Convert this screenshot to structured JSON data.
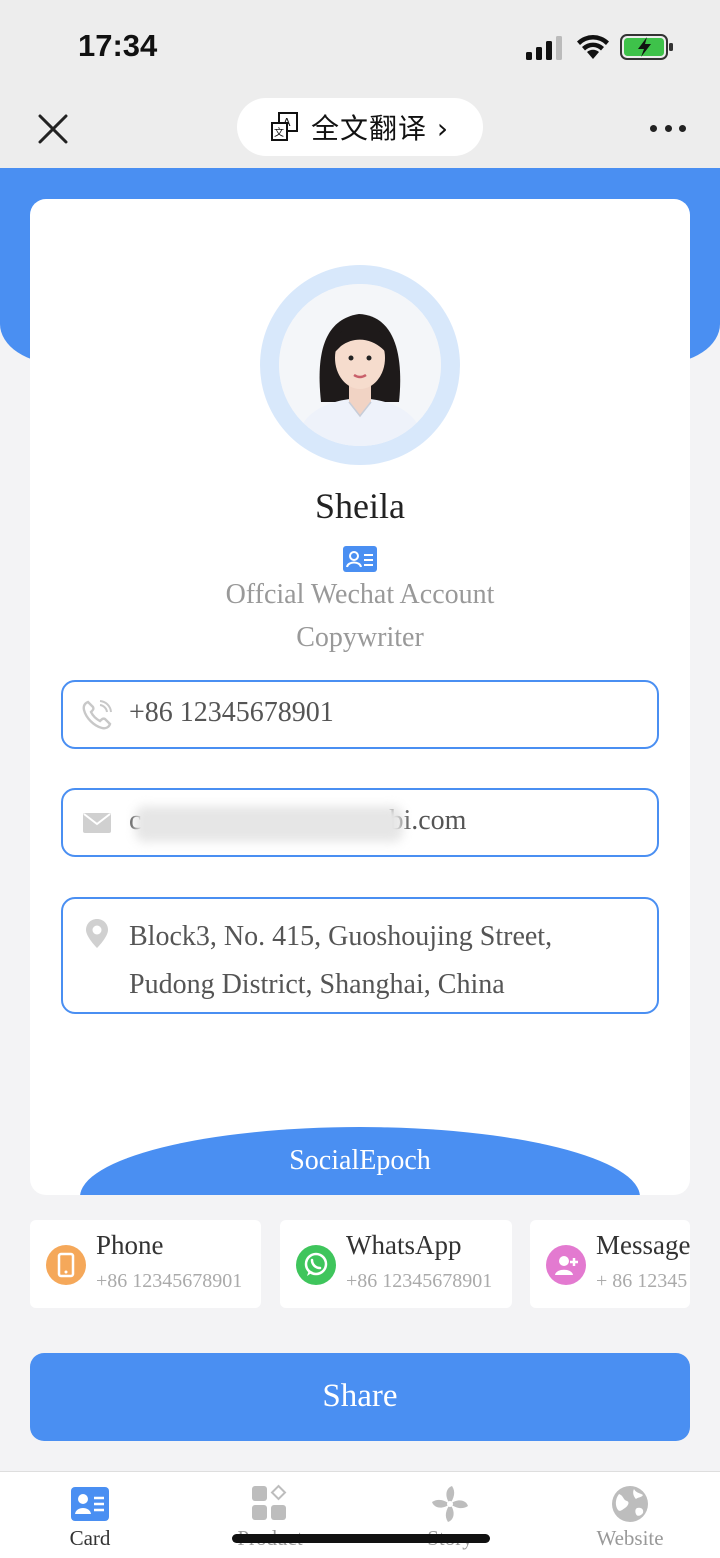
{
  "status_bar": {
    "time": "17:34"
  },
  "navbar": {
    "translate_label": "全文翻译 ›"
  },
  "profile": {
    "name": "Sheila",
    "title_line1": "Offcial Wechat Account",
    "title_line2": "Copywriter"
  },
  "contact": {
    "phone": "+86    12345678901",
    "email_visible_suffix": "bi.com",
    "email_visible_prefix": "c",
    "address": "Block3, No. 415, Guoshoujing Street, Pudong District, Shanghai, China"
  },
  "social_button_label": "SocialEpoch",
  "tiles": [
    {
      "label": "Phone",
      "number": "+86 12345678901",
      "icon": "phone-icon",
      "color": "#f5a85a"
    },
    {
      "label": "WhatsApp",
      "number": "+86 12345678901",
      "icon": "whatsapp-icon",
      "color": "#3fc55c"
    },
    {
      "label": "Message",
      "number": "+ 86 12345",
      "icon": "message-icon",
      "color": "#e37ad0"
    }
  ],
  "share_label": "Share",
  "tabbar": [
    {
      "label": "Card",
      "icon": "card-icon",
      "active": true
    },
    {
      "label": "Product",
      "icon": "product-icon",
      "active": false
    },
    {
      "label": "Story",
      "icon": "story-icon",
      "active": false
    },
    {
      "label": "Website",
      "icon": "globe-icon",
      "active": false
    }
  ],
  "colors": {
    "accent": "#4a8ff2",
    "background": "#f3f3f5",
    "bar": "#ededed"
  }
}
